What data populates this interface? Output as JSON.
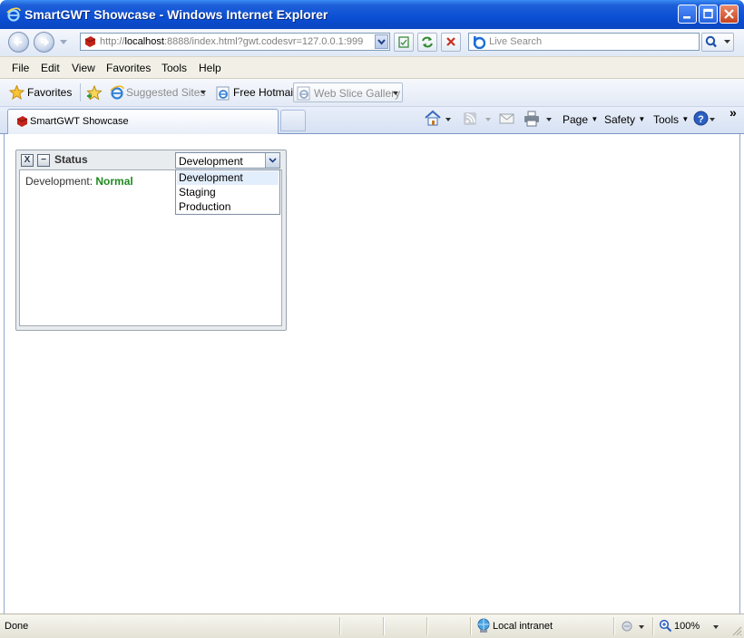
{
  "window": {
    "title": "SmartGWT Showcase - Windows Internet Explorer"
  },
  "address": {
    "url_prefix": "http://",
    "url_host": "localhost",
    "url_rest": ":8888/index.html?gwt.codesvr=127.0.0.1:999"
  },
  "search": {
    "placeholder": "Live Search"
  },
  "menu": {
    "items": [
      "File",
      "Edit",
      "View",
      "Favorites",
      "Tools",
      "Help"
    ]
  },
  "favorites": {
    "favorites_label": "Favorites",
    "suggested_sites": "Suggested Sites",
    "free_hotmail": "Free Hotmail",
    "web_slice_gallery": "Web Slice Gallery"
  },
  "tabs": {
    "active": "SmartGWT Showcase"
  },
  "commandbar": {
    "page": "Page",
    "safety": "Safety",
    "tools": "Tools",
    "chevron": "»"
  },
  "portlet": {
    "title": "Status",
    "close_label": "X",
    "minimize_label": "−",
    "select_value": "Development",
    "status_prefix": "Development:",
    "status_value": "Normal",
    "options": [
      "Development",
      "Staging",
      "Production"
    ]
  },
  "statusbar": {
    "left": "Done",
    "zone": "Local intranet",
    "zoom": "100%"
  },
  "colors": {
    "titlebar": "#0b4fd4",
    "status_ok": "#1f8a1f"
  }
}
